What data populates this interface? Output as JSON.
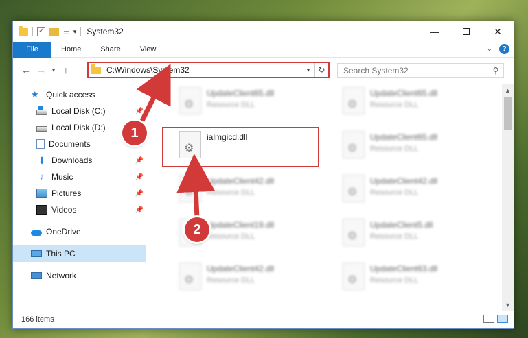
{
  "window": {
    "title": "System32",
    "controls": {
      "minimize": "—",
      "maximize": "",
      "close": "✕"
    }
  },
  "ribbon": {
    "file_tab": "File",
    "tabs": [
      "Home",
      "Share",
      "View"
    ],
    "help": "?"
  },
  "address": {
    "path": "C:\\Windows\\System32",
    "search_placeholder": "Search System32"
  },
  "nav": {
    "items": [
      {
        "label": "Quick access",
        "icon": "star-icon",
        "pinned": false
      },
      {
        "label": "Local Disk (C:)",
        "icon": "disk-icon",
        "pinned": true
      },
      {
        "label": "Local Disk (D:)",
        "icon": "disk-icon",
        "pinned": true
      },
      {
        "label": "Documents",
        "icon": "document-icon",
        "pinned": true
      },
      {
        "label": "Downloads",
        "icon": "download-icon",
        "pinned": true
      },
      {
        "label": "Music",
        "icon": "music-icon",
        "pinned": true
      },
      {
        "label": "Pictures",
        "icon": "pictures-icon",
        "pinned": true
      },
      {
        "label": "Videos",
        "icon": "videos-icon",
        "pinned": true
      },
      {
        "label": "OneDrive",
        "icon": "cloud-icon",
        "pinned": false
      },
      {
        "label": "This PC",
        "icon": "pc-icon",
        "pinned": false,
        "selected": true
      },
      {
        "label": "Network",
        "icon": "network-icon",
        "pinned": false
      }
    ]
  },
  "files": [
    {
      "name": "UpdateClient65.dll",
      "type": "Resource DLL"
    },
    {
      "name": "UpdateClient65.dll",
      "type": "Resource DLL"
    },
    {
      "name": "ialmgicd.dll",
      "type": ""
    },
    {
      "name": "UpdateClient65.dll",
      "type": "Resource DLL"
    },
    {
      "name": "UpdateClient42.dll",
      "type": "Resource DLL"
    },
    {
      "name": "UpdateClient42.dll",
      "type": "Resource DLL"
    },
    {
      "name": "UpdateClient19.dll",
      "type": "Resource DLL"
    },
    {
      "name": "UpdateClient5.dll",
      "type": "Resource DLL"
    },
    {
      "name": "UpdateClient42.dll",
      "type": "Resource DLL"
    },
    {
      "name": "UpdateClient63.dll",
      "type": "Resource DLL"
    }
  ],
  "status": {
    "item_count": "166 items"
  },
  "annotations": {
    "step1": "1",
    "step2": "2",
    "color": "#d23a3a"
  }
}
